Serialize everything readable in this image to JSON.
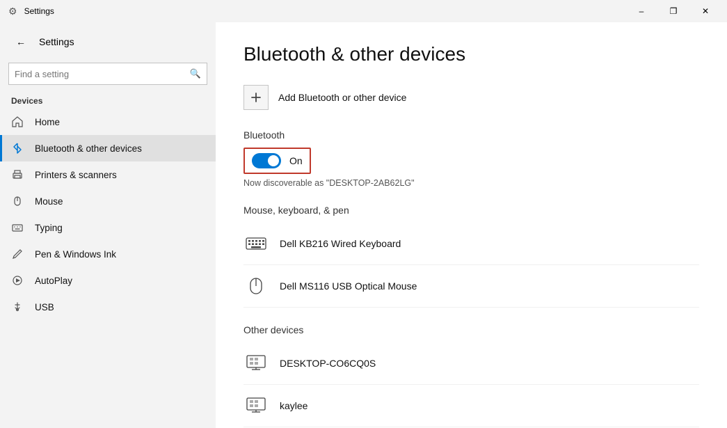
{
  "titlebar": {
    "title": "Settings",
    "minimize_label": "–",
    "maximize_label": "❐",
    "close_label": "✕"
  },
  "sidebar": {
    "app_title": "Settings",
    "search_placeholder": "Find a setting",
    "section_label": "Devices",
    "items": [
      {
        "id": "home",
        "label": "Home",
        "icon": "⌂"
      },
      {
        "id": "bluetooth",
        "label": "Bluetooth & other devices",
        "icon": "bluetooth",
        "active": true
      },
      {
        "id": "printers",
        "label": "Printers & scanners",
        "icon": "printer"
      },
      {
        "id": "mouse",
        "label": "Mouse",
        "icon": "mouse"
      },
      {
        "id": "typing",
        "label": "Typing",
        "icon": "typing"
      },
      {
        "id": "pen",
        "label": "Pen & Windows Ink",
        "icon": "pen"
      },
      {
        "id": "autoplay",
        "label": "AutoPlay",
        "icon": "autoplay"
      },
      {
        "id": "usb",
        "label": "USB",
        "icon": "usb"
      }
    ]
  },
  "content": {
    "page_title": "Bluetooth & other devices",
    "add_device_label": "Add Bluetooth or other device",
    "bluetooth_section_label": "Bluetooth",
    "toggle_on_label": "On",
    "discoverable_text": "Now discoverable as \"DESKTOP-2AB62LG\"",
    "mouse_section_label": "Mouse, keyboard, & pen",
    "other_section_label": "Other devices",
    "devices_keyboard": [
      {
        "name": "Dell KB216 Wired Keyboard",
        "icon": "keyboard"
      }
    ],
    "devices_mouse": [
      {
        "name": "Dell MS116 USB Optical Mouse",
        "icon": "mouse"
      }
    ],
    "devices_other": [
      {
        "name": "DESKTOP-CO6CQ0S",
        "icon": "monitor"
      },
      {
        "name": "kaylee",
        "icon": "monitor"
      }
    ]
  }
}
